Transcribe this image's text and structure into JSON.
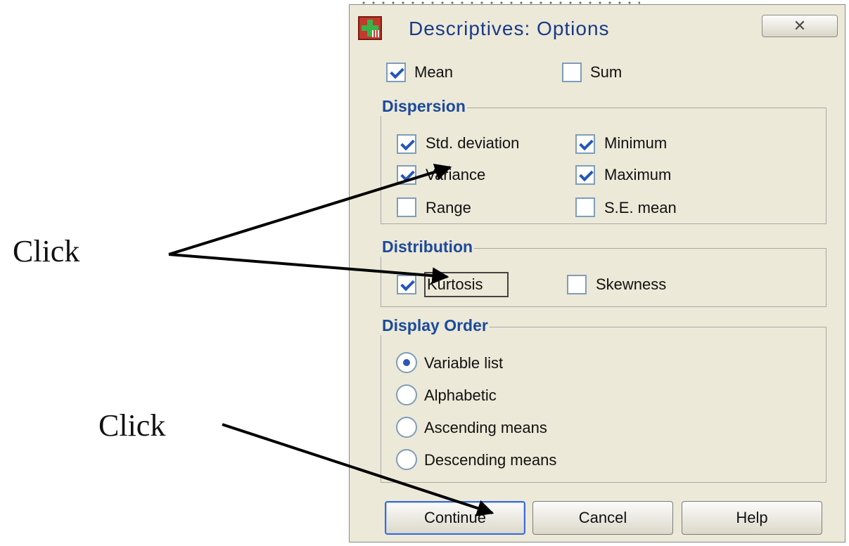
{
  "dialog": {
    "title": "Descriptives: Options",
    "close_icon": "close-icon"
  },
  "top": {
    "mean": {
      "label": "Mean",
      "checked": true
    },
    "sum": {
      "label": "Sum",
      "checked": false
    }
  },
  "dispersion": {
    "title": "Dispersion",
    "items": [
      {
        "label": "Std. deviation",
        "checked": true
      },
      {
        "label": "Minimum",
        "checked": true
      },
      {
        "label": "Variance",
        "checked": true
      },
      {
        "label": "Maximum",
        "checked": true
      },
      {
        "label": "Range",
        "checked": false
      },
      {
        "label": "S.E. mean",
        "checked": false
      }
    ]
  },
  "distribution": {
    "title": "Distribution",
    "items": [
      {
        "label": "Kurtosis",
        "checked": true
      },
      {
        "label": "Skewness",
        "checked": false
      }
    ]
  },
  "display_order": {
    "title": "Display Order",
    "options": [
      {
        "label": "Variable list",
        "selected": true
      },
      {
        "label": "Alphabetic",
        "selected": false
      },
      {
        "label": "Ascending means",
        "selected": false
      },
      {
        "label": "Descending means",
        "selected": false
      }
    ]
  },
  "buttons": {
    "continue": "Continue",
    "cancel": "Cancel",
    "help": "Help"
  },
  "annotations": {
    "click_1": "Click",
    "click_2": "Click"
  }
}
